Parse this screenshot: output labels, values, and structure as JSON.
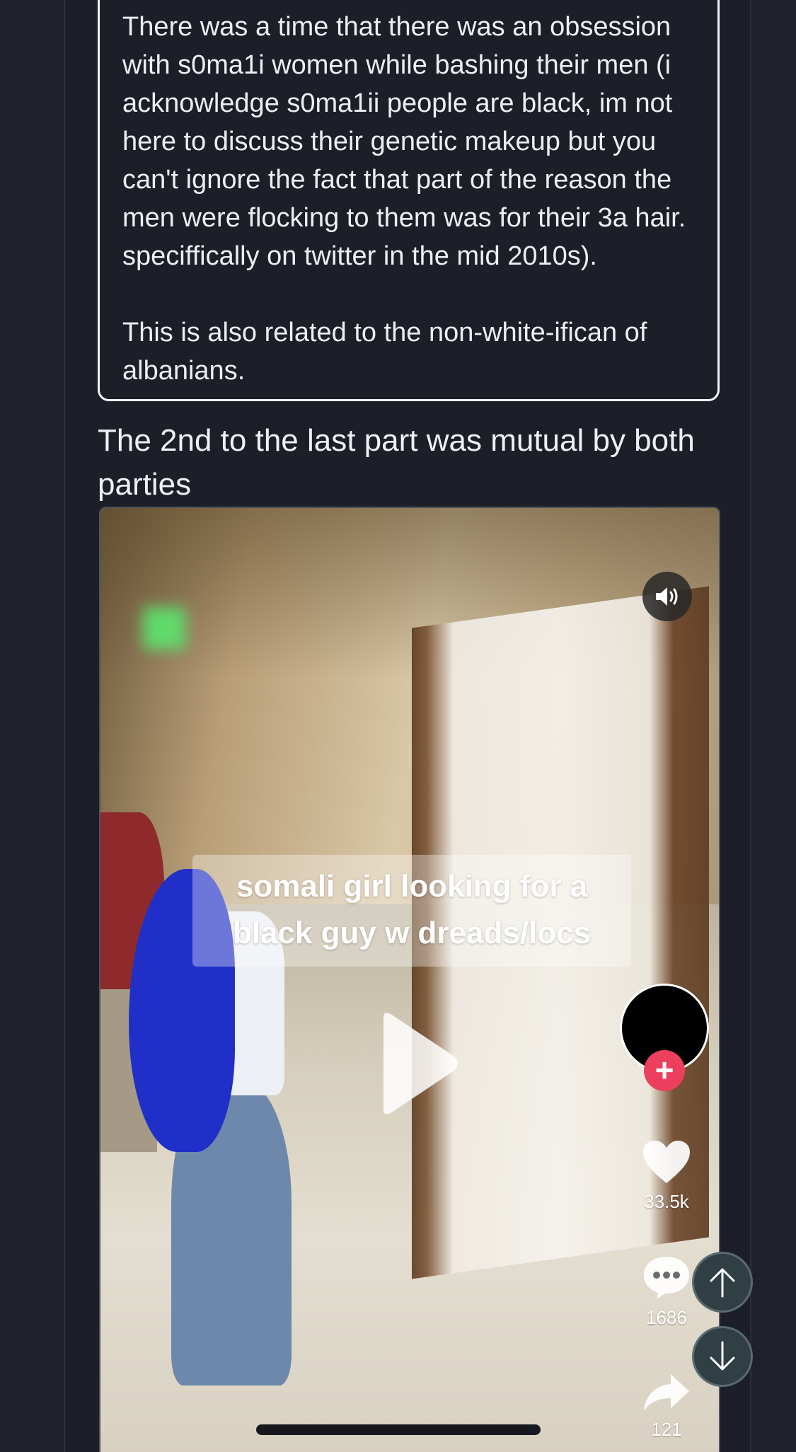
{
  "quote": {
    "paragraph1": "There was a time that there was an obsession with s0ma1i women while bashing their men (i acknowledge s0ma1ii people are black, im not here to discuss their genetic makeup but you can't ignore the fact that part of the reason the men were flocking to them was for their 3a hair. speciffically on twitter in the mid 2010s).",
    "paragraph2": "This is also related to the non-white-ifican of albanians."
  },
  "caption": "The 2nd to the last part was mutual by both parties",
  "video": {
    "overlay_line1": "somali girl looking for a",
    "overlay_line2": "black guy w dreads/locs",
    "likes": "33.5k",
    "comments": "1686",
    "shares": "121",
    "follow_symbol": "+"
  },
  "colors": {
    "background": "#1e212a",
    "follow_accent": "#ec3f5d",
    "scroll_button": "#2f3f44"
  },
  "icons": [
    "sound-icon",
    "play-icon",
    "heart-icon",
    "comment-icon",
    "share-icon",
    "arrow-up-icon",
    "arrow-down-icon"
  ]
}
